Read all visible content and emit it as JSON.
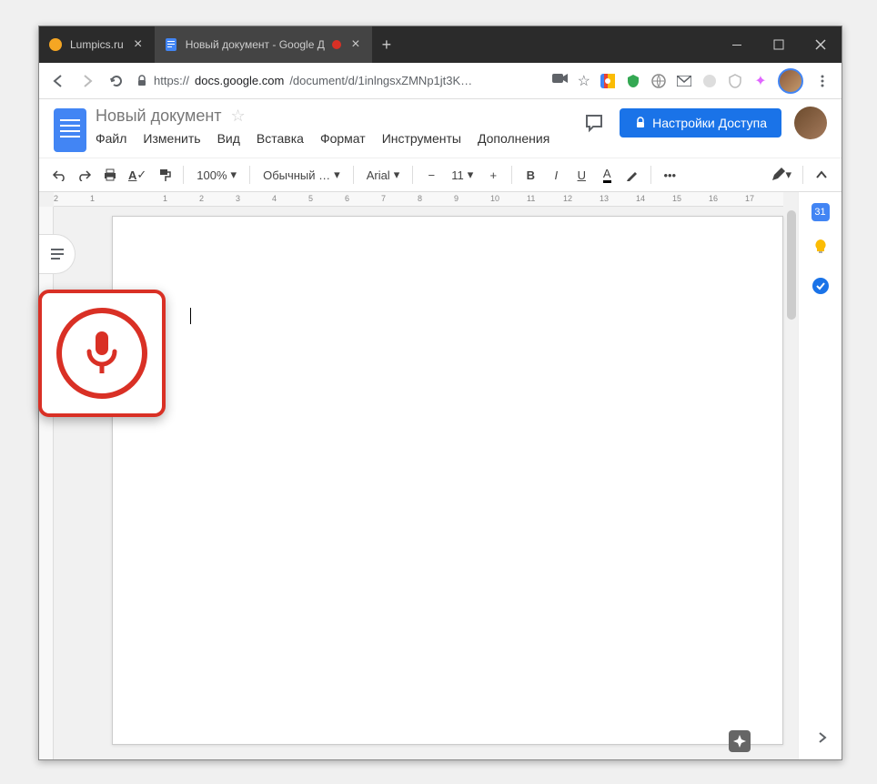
{
  "browser": {
    "tabs": [
      {
        "title": "Lumpics.ru",
        "active": false
      },
      {
        "title": "Новый документ - Google Д",
        "active": true,
        "recording": true
      }
    ],
    "url_proto": "https://",
    "url_domain": "docs.google.com",
    "url_path": "/document/d/1inlngsxZMNp1jt3K…"
  },
  "docs": {
    "title": "Новый документ",
    "menu": [
      "Файл",
      "Изменить",
      "Вид",
      "Вставка",
      "Формат",
      "Инструменты",
      "Дополнения"
    ],
    "share_label": "Настройки Доступа"
  },
  "toolbar": {
    "zoom": "100%",
    "style": "Обычный …",
    "font": "Arial",
    "size": "11"
  },
  "ruler": {
    "marks": [
      "2",
      "1",
      "",
      "1",
      "2",
      "3",
      "4",
      "5",
      "6",
      "7",
      "8",
      "9",
      "10",
      "11",
      "12",
      "13",
      "14",
      "15",
      "16",
      "17"
    ]
  },
  "sidepanel": {
    "calendar_day": "31"
  }
}
